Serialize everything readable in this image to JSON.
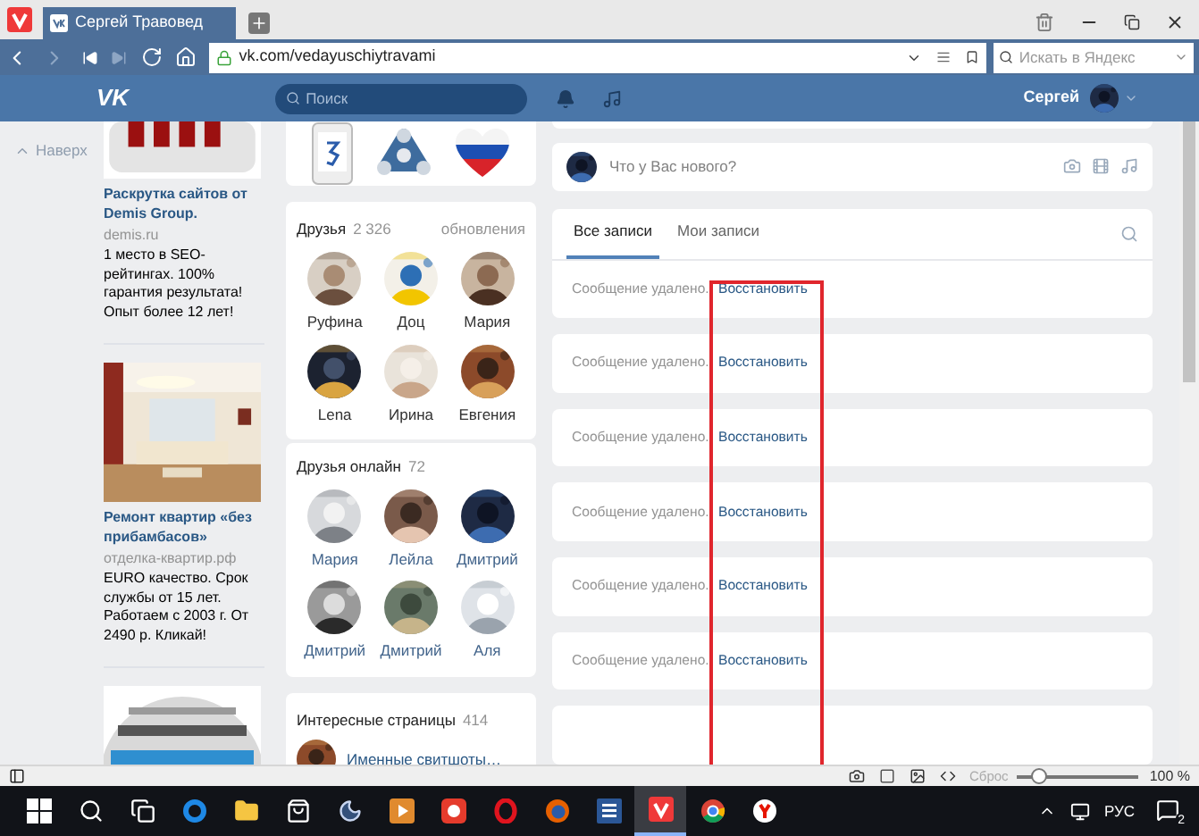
{
  "browser": {
    "tabs": [
      {
        "title": "Сергей Травовед",
        "selected": true
      }
    ],
    "url": "vk.com/vedayuschiytravami",
    "search_placeholder": "Искать в Яндекс"
  },
  "vk_header": {
    "logo": "VK",
    "search_placeholder": "Поиск",
    "user_name": "Сергей"
  },
  "back_to_top": "Наверх",
  "ads": [
    {
      "kind": "text-ad",
      "title": "Раскрутка сайтов от Demis Group.",
      "domain": "demis.ru",
      "text": "1 место в SEO-рейтингах. 100% гарантия результата! Опыт более 12 лет!"
    },
    {
      "kind": "text-ad",
      "title": "Ремонт квартир «без прибамбасов»",
      "domain": "отделка-квартир.рф",
      "text": "EURO качество. Срок службы от 15 лет. Работаем с 2003 г. От 2490 р. Кликай!"
    },
    {
      "kind": "picture"
    }
  ],
  "friends": {
    "title": "Друзья",
    "count": "2 326",
    "link": "обновления",
    "people": [
      "Руфина",
      "Доц",
      "Мария",
      "Lena",
      "Ирина",
      "Евгения"
    ]
  },
  "online_friends": {
    "title": "Друзья онлайн",
    "count": "72",
    "people": [
      "Мария",
      "Лейла",
      "Дмитрий",
      "Дмитрий",
      "Дмитрий",
      "Аля"
    ]
  },
  "interesting_pages": {
    "title": "Интересные страницы",
    "count": "414",
    "items": [
      "Именные свитшоты…"
    ]
  },
  "post_box": {
    "placeholder": "Что у Вас нового?"
  },
  "feed": {
    "tabs": [
      {
        "label": "Все записи",
        "selected": true
      },
      {
        "label": "Мои записи",
        "selected": false
      }
    ],
    "posts": [
      {
        "text": "Сообщение удалено.",
        "link": "Восстановить"
      },
      {
        "text": "Сообщение удалено.",
        "link": "Восстановить"
      },
      {
        "text": "Сообщение удалено.",
        "link": "Восстановить"
      },
      {
        "text": "Сообщение удалено.",
        "link": "Восстановить"
      },
      {
        "text": "Сообщение удалено.",
        "link": "Восстановить"
      },
      {
        "text": "Сообщение удалено.",
        "link": "Восстановить"
      }
    ]
  },
  "status_bar": {
    "reset": "Сброс",
    "zoom_slider": {
      "level": 0.17
    },
    "zoom": "100 %"
  },
  "taskbar": {
    "apps": [
      {
        "kind": "start",
        "selected": false
      },
      {
        "kind": "search",
        "selected": false
      },
      {
        "kind": "task-view",
        "selected": false
      },
      {
        "kind": "edge",
        "selected": false
      },
      {
        "kind": "explorer",
        "selected": false
      },
      {
        "kind": "store",
        "selected": false
      },
      {
        "kind": "moon",
        "selected": false
      },
      {
        "kind": "media",
        "selected": false
      },
      {
        "kind": "recorder",
        "selected": false
      },
      {
        "kind": "opera",
        "selected": false
      },
      {
        "kind": "firefox",
        "selected": false
      },
      {
        "kind": "word",
        "selected": false
      },
      {
        "kind": "vivaldi",
        "selected": true
      },
      {
        "kind": "chrome",
        "selected": false
      },
      {
        "kind": "yandex",
        "selected": false
      }
    ],
    "language": "РУС",
    "notifications": "2"
  }
}
